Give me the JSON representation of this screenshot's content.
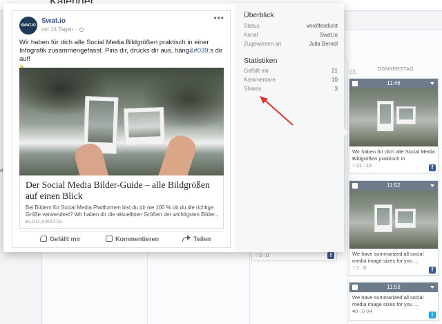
{
  "background": {
    "page_title": "Kalender",
    "nav_item": "o",
    "day_header": "DONNERSTAG",
    "day_number": "03.",
    "cards_col3": [
      {
        "stats": "♡2 ◌0",
        "network": "f"
      }
    ],
    "cards_col4": [
      {
        "time": "11:46",
        "text": "Wir haben für dich alle Social Media Bildgrößen praktisch in",
        "stats": "♡21 ◌10",
        "network": "f"
      },
      {
        "time": "11:52",
        "text": "We have summarized all social media image sizes for you ...",
        "stats": "♡1 ◌0",
        "network": "f"
      },
      {
        "time": "11:53",
        "text": "We have summarized all social media image sizes for you ...",
        "stats": "♥0 ◌0 ⟳4",
        "network": "t"
      }
    ]
  },
  "post": {
    "page_name": "Swat.io",
    "avatar_text": "SWAT.IO",
    "time": "vor 14 Tagen ·",
    "more": "•••",
    "text": "Wir haben für dich alle Social Media Bildgrößen praktisch in einer Infografik zusammengefasst. Pins dir, drucks dir aus, häng",
    "text_tag": "&#039;",
    "text_end": "s dir auf!",
    "text_tail": "📐",
    "link_title": "Der Social Media Bilder-Guide – alle Bildgrößen auf einen Blick",
    "link_desc_line1": "Bei Bildern für Social Media Plattformen bist du dir nie 100 % ob du die richtige",
    "link_desc_line2": "Größe verwendest? Wir haben dir die aktuellsten Größen der wichtigsten Bilder...",
    "link_domain": "BLOG.SWAT.IO",
    "actions": {
      "like": "Gefällt mir",
      "comment": "Kommentieren",
      "share": "Teilen"
    }
  },
  "overview": {
    "heading": "Überblick",
    "rows": [
      {
        "label": "Status",
        "value": "veröffentlicht"
      },
      {
        "label": "Kanal",
        "value": "Swat.io"
      },
      {
        "label": "Zugewiesen an",
        "value": "Julia Berndl"
      }
    ]
  },
  "statistics": {
    "heading": "Statistiken",
    "rows": [
      {
        "label": "Gefällt mir",
        "value": "21"
      },
      {
        "label": "Kommentare",
        "value": "10"
      },
      {
        "label": "Shares",
        "value": "3"
      }
    ]
  },
  "colors": {
    "facebook": "#3b5998",
    "twitter": "#1da1f2",
    "annotation_arrow": "#e5332a",
    "link_blue": "#365899"
  },
  "icons": [
    "like-icon",
    "comment-icon",
    "share-icon",
    "globe-icon",
    "more-icon",
    "facebook-icon",
    "twitter-icon",
    "dropdown-icon",
    "checkbox-icon"
  ]
}
